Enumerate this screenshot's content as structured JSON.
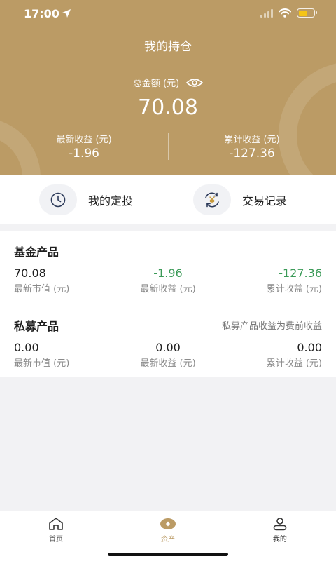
{
  "status_bar": {
    "time": "17:00"
  },
  "header": {
    "title": "我的持仓",
    "total_label": "总金额 (元)",
    "total_value": "70.08",
    "stats": [
      {
        "label": "最新收益 (元)",
        "value": "-1.96"
      },
      {
        "label": "累计收益 (元)",
        "value": "-127.36"
      }
    ]
  },
  "actions": [
    {
      "label": "我的定投",
      "icon": "clock-icon"
    },
    {
      "label": "交易记录",
      "icon": "yuan-exchange-icon"
    }
  ],
  "fund_products": {
    "title": "基金产品",
    "columns": [
      {
        "value": "70.08",
        "label": "最新市值 (元)"
      },
      {
        "value": "-1.96",
        "label": "最新收益 (元)"
      },
      {
        "value": "-127.36",
        "label": "累计收益 (元)"
      }
    ]
  },
  "private_products": {
    "title": "私募产品",
    "note": "私募产品收益为费前收益",
    "columns": [
      {
        "value": "0.00",
        "label": "最新市值 (元)"
      },
      {
        "value": "0.00",
        "label": "最新收益 (元)"
      },
      {
        "value": "0.00",
        "label": "累计收益 (元)"
      }
    ]
  },
  "tabbar": {
    "items": [
      {
        "label": "首页",
        "icon": "home-icon"
      },
      {
        "label": "资产",
        "icon": "assets-icon",
        "active": true
      },
      {
        "label": "我的",
        "icon": "profile-icon"
      }
    ]
  },
  "colors": {
    "brand": "#bb9b65",
    "gain_negative": "#3a9a57",
    "battery": "#f5c518"
  }
}
